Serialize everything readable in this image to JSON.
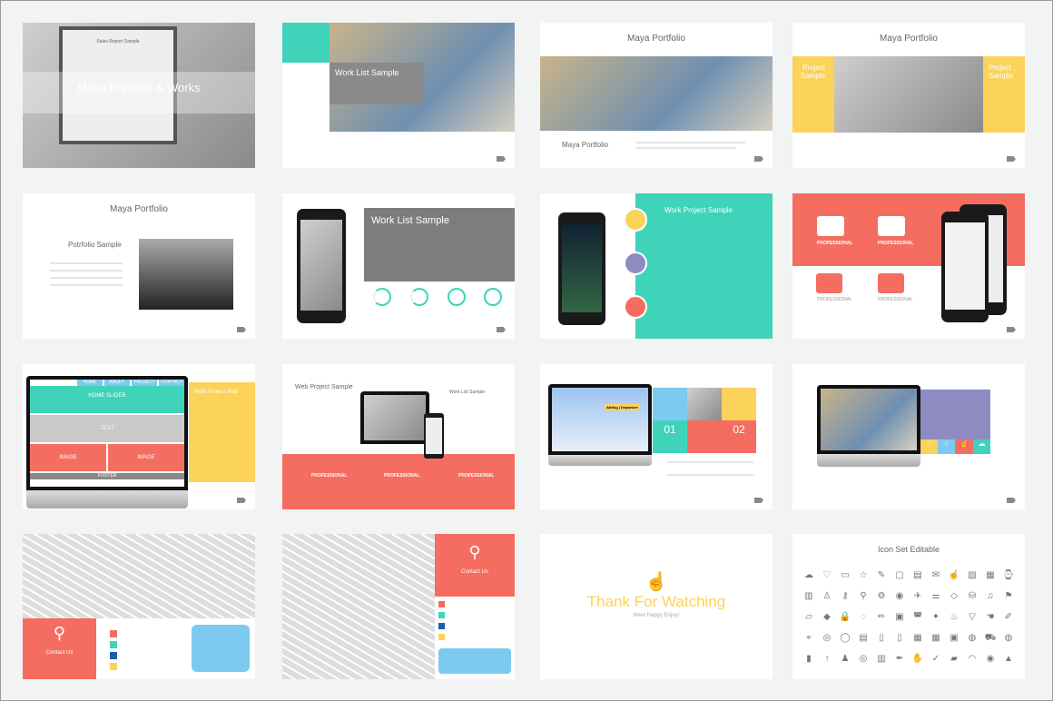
{
  "colors": {
    "teal": "#3fd3b9",
    "yellow": "#fbd25a",
    "coral": "#f56d61",
    "gray": "#888888",
    "blue": "#7ccaef",
    "purple": "#8e8bc3",
    "background": "#f2f3f3"
  },
  "slides": [
    {
      "title": "Maya Portfolio & Works",
      "screen_title": "Sales Report Sample"
    },
    {
      "title": "Work List Sample"
    },
    {
      "title": "Maya Portfolio",
      "caption": "Maya Portfolio"
    },
    {
      "title": "Maya Portfolio",
      "left_label": "Project Sample",
      "right_label": "Project Sample"
    },
    {
      "title": "Maya Portfolio",
      "subtitle": "Potrfolio Sample"
    },
    {
      "title": "Work List Sample"
    },
    {
      "title": "Work Project Sample"
    },
    {
      "labels": [
        "PROFESSIONAL",
        "PROFESSIONAL",
        "PROFESSIONAL",
        "PROFESSIONAL"
      ]
    },
    {
      "nav": [
        "HOME",
        "ABOUT",
        "PROJECT",
        "CONTACT"
      ],
      "slider": "HOME SLIDER",
      "text": "TEXT",
      "image1": "IMAGE",
      "image2": "IMAGE",
      "footer": "FOOTER",
      "side_title": "Work Project Web"
    },
    {
      "title": "Web Project Sample",
      "side_title": "Work List Sample",
      "labels": [
        "PROFESSIONAL",
        "PROFESSIONAL",
        "PROFESSIONAL"
      ]
    },
    {
      "sign": "Abflug | Departure",
      "num1": "01",
      "num2": "02"
    },
    {
      "icons": [
        "heart-icon",
        "star-icon",
        "thumbs-up-icon",
        "cloud-icon"
      ]
    },
    {
      "title": "Contact Us"
    },
    {
      "title": "Contact Us"
    },
    {
      "title": "Thank For Watching",
      "subtitle": "Meet Happy Enjoy!"
    },
    {
      "title": "Icon Set Editable",
      "icons": [
        "☁",
        "♡",
        "▭",
        "☆",
        "✎",
        "▢",
        "▤",
        "✉",
        "☝",
        "▧",
        "▦",
        "⌚",
        "▥",
        "♙",
        "⚷",
        "⚲",
        "⚙",
        "◉",
        "✈",
        "⚌",
        "◇",
        "⛁",
        "♫",
        "⚑",
        "▱",
        "◆",
        "🔒",
        "◌",
        "✏",
        "▣",
        "◚",
        "✦",
        "♨",
        "▽",
        "☚",
        "✐",
        "⌖",
        "◎",
        "◯",
        "▤",
        "▯",
        "▯",
        "▦",
        "▦",
        "▣",
        "◍",
        "⛟",
        "◍",
        "▮",
        "↑",
        "♟",
        "◎",
        "▥",
        "✒",
        "✋",
        "✓",
        "▰",
        "◠",
        "◉",
        "▲"
      ]
    }
  ]
}
